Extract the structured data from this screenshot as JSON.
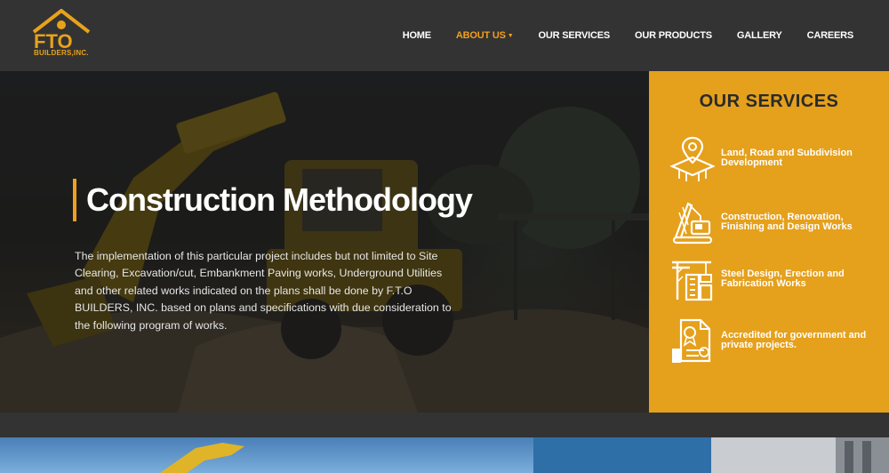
{
  "brand": {
    "logo_text": "FTO",
    "logo_subtitle": "BUILDERS,INC."
  },
  "nav": {
    "items": [
      {
        "label": "HOME",
        "active": false
      },
      {
        "label": "ABOUT US",
        "active": true,
        "has_dropdown": true
      },
      {
        "label": "OUR SERVICES",
        "active": false
      },
      {
        "label": "OUR PRODUCTS",
        "active": false
      },
      {
        "label": "GALLERY",
        "active": false
      },
      {
        "label": "CAREERS",
        "active": false
      }
    ]
  },
  "hero": {
    "title": "Construction Methodology",
    "text": "The implementation of this particular project includes but not limited to Site Clearing, Excavation/cut, Embankment Paving works, Underground Utilities and other related works indicated on the plans shall be done by F.T.O BUILDERS, INC. based on plans and specifications with due consideration to the following program of works."
  },
  "services": {
    "title": "OUR SERVICES",
    "items": [
      {
        "icon": "land-plot-icon",
        "label": "Land, Road and Subdivision Development"
      },
      {
        "icon": "crane-icon",
        "label": "Construction, Renovation, Finishing and Design Works"
      },
      {
        "icon": "steel-building-icon",
        "label": "Steel Design, Erection and Fabrication Works"
      },
      {
        "icon": "certificate-icon",
        "label": "Accredited for government and private projects."
      }
    ]
  },
  "colors": {
    "accent": "#f0a01e",
    "panel": "#e5a01c",
    "header_bg": "#333333"
  }
}
